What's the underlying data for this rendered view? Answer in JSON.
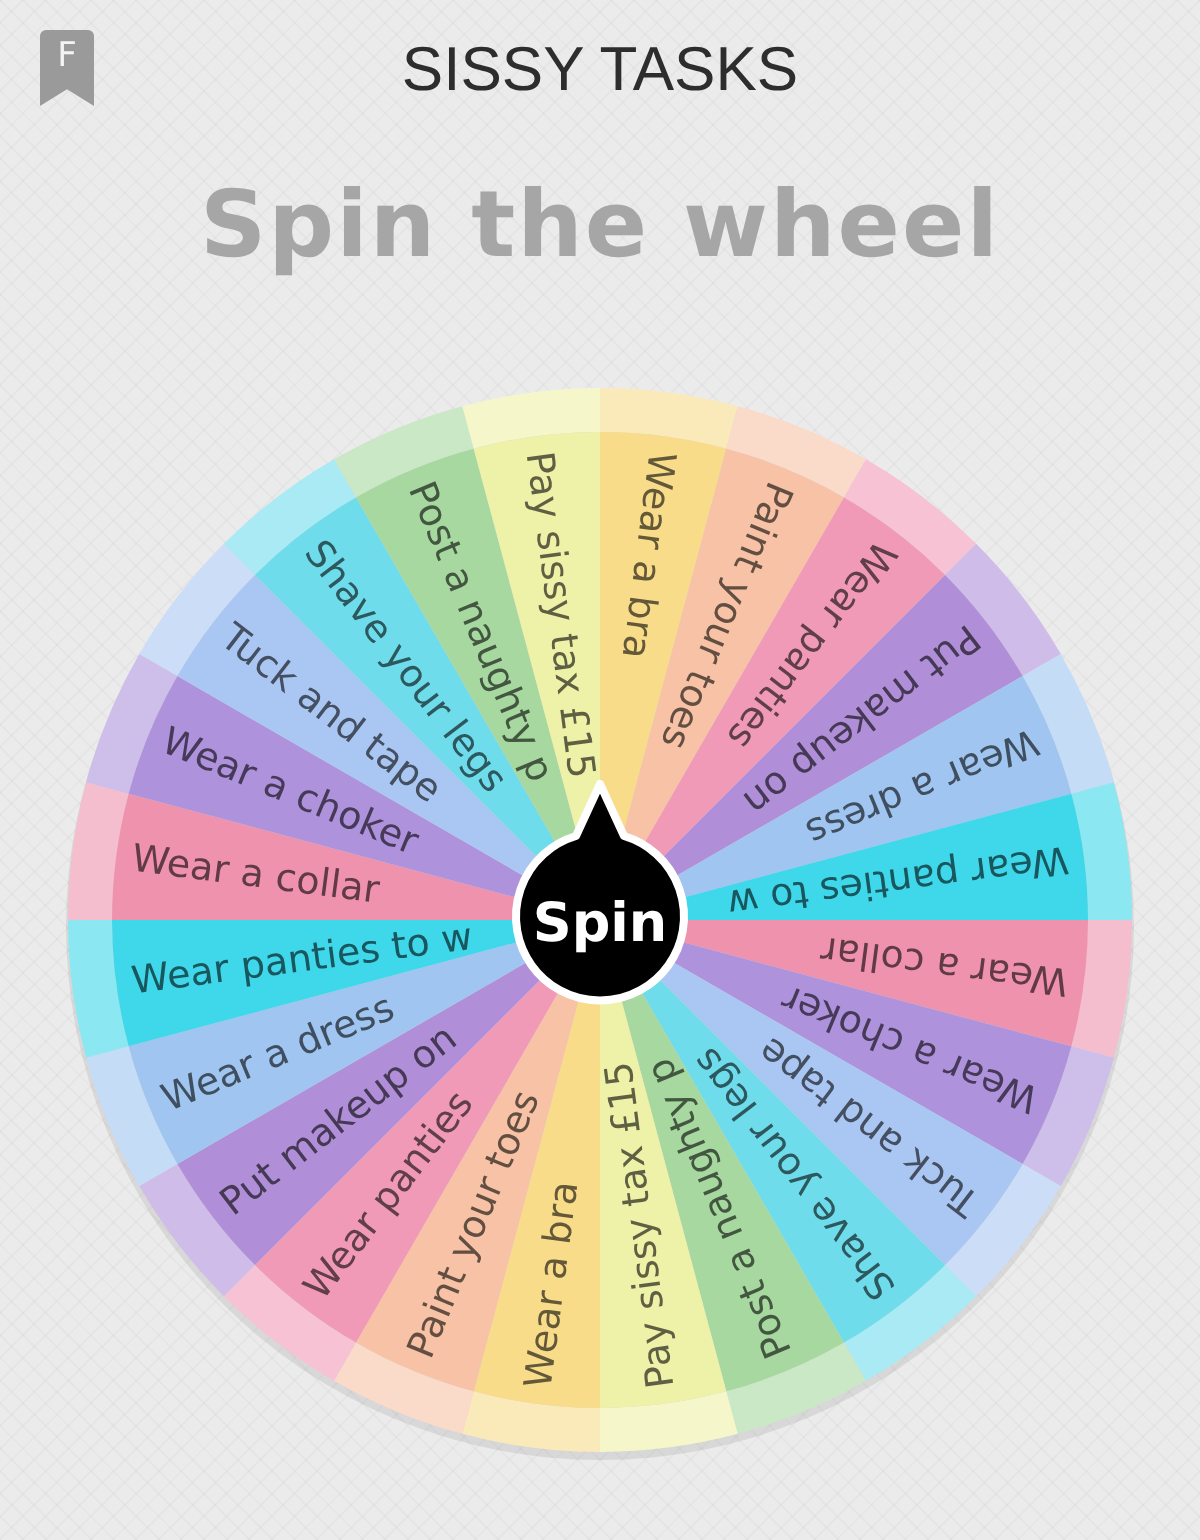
{
  "header": {
    "badge": "F",
    "title": "SISSY TASKS",
    "heading": "Spin the wheel"
  },
  "wheel": {
    "spin_button": "Spin",
    "segments": [
      {
        "label": "Wear a bra",
        "color": "#f8dc8a"
      },
      {
        "label": "Paint your toes",
        "color": "#f7c2a5"
      },
      {
        "label": "Wear panties",
        "color": "#f09ab8"
      },
      {
        "label": "Put makeup on",
        "color": "#b08fd8"
      },
      {
        "label": "Wear a dress",
        "color": "#9fc5f0"
      },
      {
        "label": "Wear panties to w",
        "color": "#3ed8ea"
      },
      {
        "label": "Wear a collar",
        "color": "#ef92ad"
      },
      {
        "label": "Wear a choker",
        "color": "#ae92dc"
      },
      {
        "label": "Tuck and tape",
        "color": "#a9c7f2"
      },
      {
        "label": "Shave your legs",
        "color": "#6fdcec"
      },
      {
        "label": "Post a naughty p",
        "color": "#a7d8a0"
      },
      {
        "label": "Pay sissy tax £15",
        "color": "#eef1a8"
      },
      {
        "label": "Wear a bra",
        "color": "#f8dc8a"
      },
      {
        "label": "Paint your toes",
        "color": "#f7c2a5"
      },
      {
        "label": "Wear panties",
        "color": "#f09ab8"
      },
      {
        "label": "Put makeup on",
        "color": "#b08fd8"
      },
      {
        "label": "Wear a dress",
        "color": "#9fc5f0"
      },
      {
        "label": "Wear panties to w",
        "color": "#3ed8ea"
      },
      {
        "label": "Wear a collar",
        "color": "#ef92ad"
      },
      {
        "label": "Wear a choker",
        "color": "#ae92dc"
      },
      {
        "label": "Tuck and tape",
        "color": "#a9c7f2"
      },
      {
        "label": "Shave your legs",
        "color": "#6fdcec"
      },
      {
        "label": "Post a naughty p",
        "color": "#a7d8a0"
      },
      {
        "label": "Pay sissy tax £15",
        "color": "#eef1a8"
      }
    ]
  }
}
